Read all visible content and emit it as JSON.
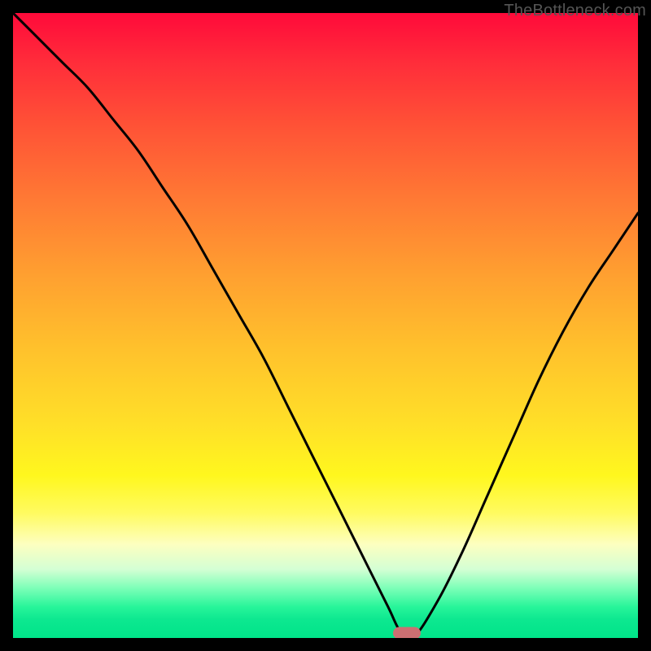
{
  "watermark": "TheBottleneck.com",
  "colors": {
    "frame_background": "#000000",
    "gradient_top": "#ff0a3a",
    "gradient_bottom": "#00e489",
    "curve": "#000000",
    "marker": "#cc6f72"
  },
  "chart_data": {
    "type": "line",
    "title": "",
    "xlabel": "",
    "ylabel": "",
    "xlim": [
      0,
      100
    ],
    "ylim": [
      0,
      100
    ],
    "grid": false,
    "legend": false,
    "annotations": [],
    "series": [
      {
        "name": "bottleneck-curve",
        "x": [
          0,
          4,
          8,
          12,
          16,
          20,
          24,
          28,
          32,
          36,
          40,
          44,
          48,
          52,
          56,
          60,
          62,
          64,
          68,
          72,
          76,
          80,
          84,
          88,
          92,
          96,
          100
        ],
        "values": [
          100,
          96,
          92,
          88,
          83,
          78,
          72,
          66,
          59,
          52,
          45,
          37,
          29,
          21,
          13,
          5,
          1,
          0,
          6,
          14,
          23,
          32,
          41,
          49,
          56,
          62,
          68
        ]
      }
    ],
    "marker": {
      "x": 63,
      "y": 0,
      "shape": "rounded-rect"
    }
  }
}
